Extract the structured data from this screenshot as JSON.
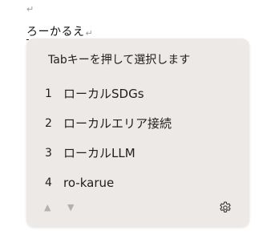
{
  "document": {
    "paragraph_mark": "↵",
    "composition_text": "ろーかるえ",
    "composition_end_mark": "↵"
  },
  "candidate_window": {
    "hint": "Tabキーを押して選択します",
    "candidates": [
      {
        "number": "1",
        "text": "ローカルSDGs"
      },
      {
        "number": "2",
        "text": "ローカルエリア接続"
      },
      {
        "number": "3",
        "text": "ローカルLLM"
      },
      {
        "number": "4",
        "text": "ro-karue"
      }
    ],
    "footer": {
      "prev_icon": "triangle-up-icon",
      "next_icon": "triangle-down-icon",
      "settings_icon": "gear-icon"
    }
  }
}
